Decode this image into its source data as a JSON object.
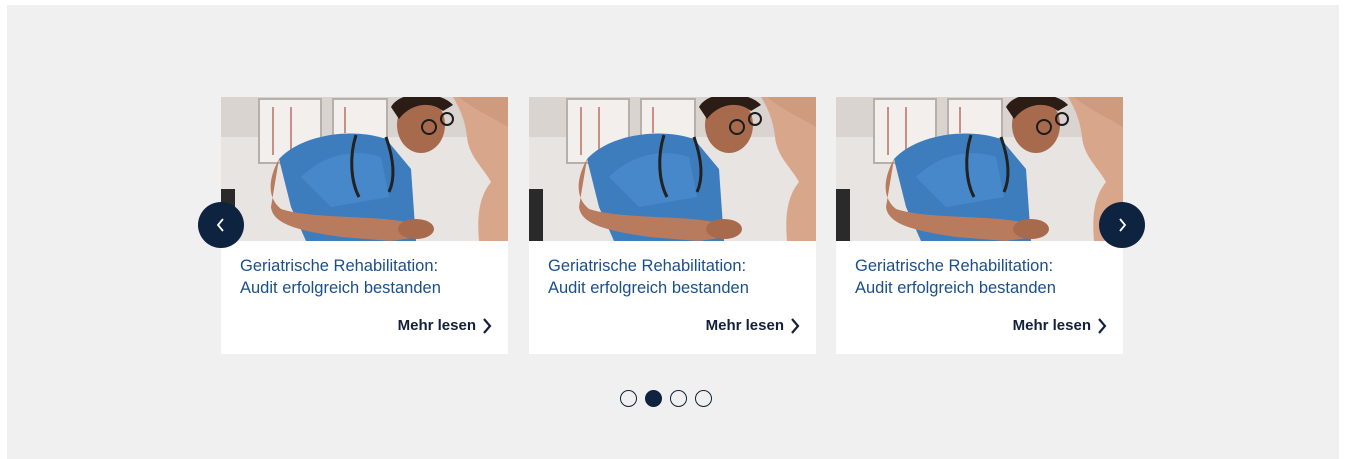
{
  "carousel": {
    "prev_icon": "chevron-left-icon",
    "next_icon": "chevron-right-icon",
    "active_slide": 2,
    "slide_count": 4,
    "colors": {
      "accent": "#0d2340",
      "title": "#1b4f8a",
      "background": "#f0f0f0"
    },
    "cards": [
      {
        "title_line1": "Geriatrische Rehabilitation:",
        "title_line2": "Audit erfolgreich bestanden",
        "more_label": "Mehr lesen"
      },
      {
        "title_line1": "Geriatrische Rehabilitation:",
        "title_line2": "Audit erfolgreich bestanden",
        "more_label": "Mehr lesen"
      },
      {
        "title_line1": "Geriatrische Rehabilitation:",
        "title_line2": "Audit erfolgreich bestanden",
        "more_label": "Mehr lesen"
      }
    ]
  }
}
